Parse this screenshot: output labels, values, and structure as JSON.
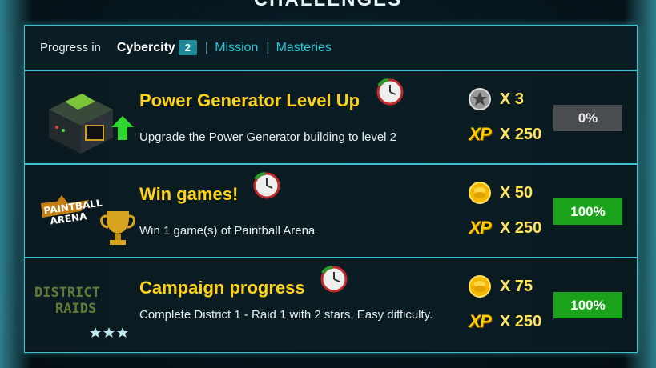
{
  "page": {
    "title": "CHALLENGES"
  },
  "header": {
    "label": "Progress in",
    "current": "Cybercity",
    "badge": "2",
    "links": [
      "Mission",
      "Masteries"
    ]
  },
  "challenges": [
    {
      "title": "Power Generator Level Up",
      "description": "Upgrade the Power Generator building to level 2",
      "reward1_icon": "star-token-icon",
      "reward1": "X 3",
      "reward2": "X 250",
      "progress": "0%",
      "progress_fraction": 0
    },
    {
      "title": "Win games!",
      "description": "Win 1 game(s) of Paintball Arena",
      "thumb_text": "PAINTBALL ARENA",
      "reward1_icon": "coin-icon",
      "reward1": "X 50",
      "reward2": "X 250",
      "progress": "100%",
      "progress_fraction": 1
    },
    {
      "title": "Campaign progress",
      "description": "Complete District 1 - Raid 1 with 2 stars, Easy difficulty.",
      "thumb_text_1": "DISTRICT",
      "thumb_text_2": "RAIDS",
      "reward1_icon": "coin-icon",
      "reward1": "X 75",
      "reward2": "X 250",
      "progress": "100%",
      "progress_fraction": 1
    }
  ],
  "xp_label": "XP",
  "colors": {
    "accent": "#3fc2cf",
    "title": "#ffd21a",
    "complete": "#1aa31a",
    "incomplete": "#4a4d50"
  }
}
